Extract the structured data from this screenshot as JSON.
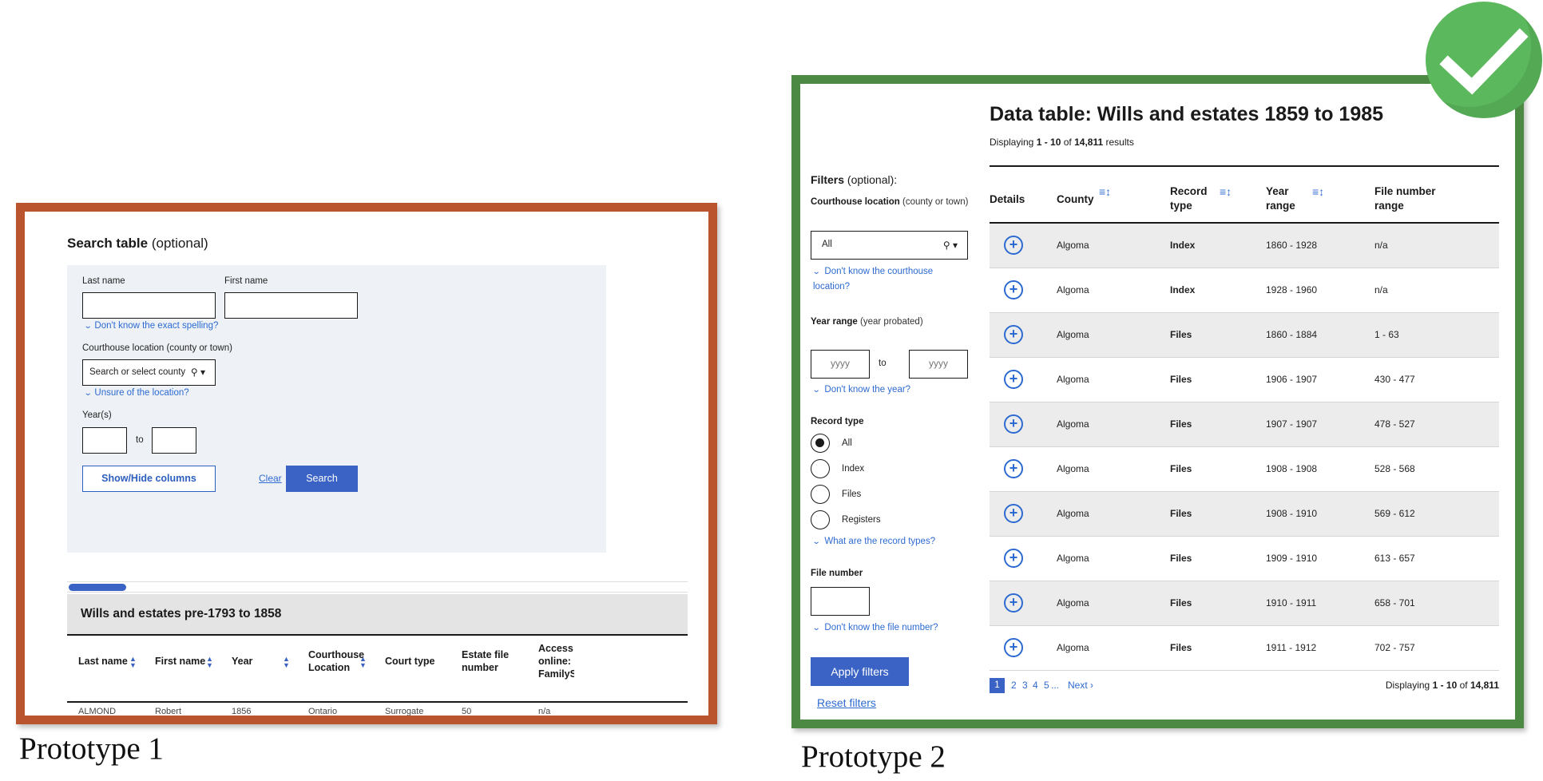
{
  "prototype1": {
    "caption": "Prototype 1",
    "frame_color": "#b9542e",
    "search_title": "Search table",
    "search_title_optional": "(optional)",
    "last_name_label": "Last name",
    "first_name_label": "First name",
    "spelling_hint": "Don't know the exact spelling?",
    "courthouse_label": "Courthouse location (county or town)",
    "county_placeholder": "Search or select county",
    "location_hint": "Unsure of the location?",
    "years_label": "Year(s)",
    "to_label": "to",
    "show_hide_button": "Show/Hide columns",
    "clear_link": "Clear",
    "search_button": "Search",
    "table_caption": "Wills and estates pre-1793 to 1858",
    "columns": [
      "Last name",
      "First name",
      "Year",
      "Courthouse Location",
      "Court type",
      "Estate file number",
      "Access online: FamilyS"
    ],
    "first_row_partial": [
      "ALMOND",
      "Robert",
      "1856",
      "Ontario",
      "Surrogate",
      "50",
      "n/a"
    ]
  },
  "prototype2": {
    "caption": "Prototype 2",
    "frame_color": "#4c8a44",
    "title": "Data table: Wills and estates 1859 to 1985",
    "displaying_prefix": "Displaying",
    "displaying_range": "1 - 10",
    "displaying_of": "of",
    "displaying_total": "14,811",
    "displaying_suffix": "results",
    "filters_title": "Filters",
    "filters_optional": "(optional):",
    "courthouse_label": "Courthouse location",
    "courthouse_sub": "(county or town)",
    "county_value": "All",
    "courthouse_hint": "Don't know the courthouse location?",
    "year_range_label": "Year range",
    "year_range_sub": "(year probated)",
    "year_placeholder": "yyyy",
    "to_label": "to",
    "year_hint": "Don't know the year?",
    "record_type_label": "Record type",
    "record_types": [
      "All",
      "Index",
      "Files",
      "Registers"
    ],
    "record_type_selected": "All",
    "record_type_hint": "What are the record types?",
    "file_number_label": "File number",
    "file_number_hint": "Don't know the file number?",
    "apply_button": "Apply filters",
    "reset_link": "Reset filters",
    "columns": [
      "Details",
      "County",
      "Record type",
      "Year range",
      "File number range"
    ],
    "rows": [
      {
        "county": "Algoma",
        "record_type": "Index",
        "year_range": "1860 - 1928",
        "file_range": "n/a"
      },
      {
        "county": "Algoma",
        "record_type": "Index",
        "year_range": "1928 - 1960",
        "file_range": "n/a"
      },
      {
        "county": "Algoma",
        "record_type": "Files",
        "year_range": "1860 - 1884",
        "file_range": "1 - 63"
      },
      {
        "county": "Algoma",
        "record_type": "Files",
        "year_range": "1906 - 1907",
        "file_range": "430 - 477"
      },
      {
        "county": "Algoma",
        "record_type": "Files",
        "year_range": "1907 - 1907",
        "file_range": "478 - 527"
      },
      {
        "county": "Algoma",
        "record_type": "Files",
        "year_range": "1908 - 1908",
        "file_range": "528 - 568"
      },
      {
        "county": "Algoma",
        "record_type": "Files",
        "year_range": "1908 - 1910",
        "file_range": "569 - 612"
      },
      {
        "county": "Algoma",
        "record_type": "Files",
        "year_range": "1909 - 1910",
        "file_range": "613 - 657"
      },
      {
        "county": "Algoma",
        "record_type": "Files",
        "year_range": "1910 - 1911",
        "file_range": "658 - 701"
      },
      {
        "county": "Algoma",
        "record_type": "Files",
        "year_range": "1911 - 1912",
        "file_range": "702 - 757"
      }
    ],
    "pagination": {
      "current": "1",
      "pages": [
        "2",
        "3",
        "4",
        "5"
      ],
      "ellipsis": "...",
      "next": "Next ›"
    },
    "badge_color": "#5cb85c"
  }
}
